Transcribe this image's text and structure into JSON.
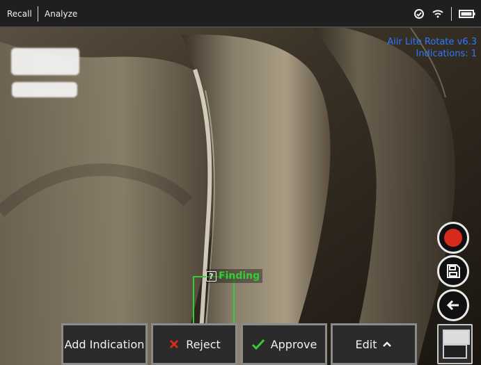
{
  "topbar": {
    "left_items": [
      "Recall",
      "Analyze"
    ],
    "status_icons": [
      "sync-check-icon",
      "wifi-icon",
      "battery-icon"
    ]
  },
  "overlay": {
    "software": "Aiir Lite Rotate v6.3",
    "indications": "Indications: 1"
  },
  "finding": {
    "label": "Finding"
  },
  "actions": {
    "add_indication": "Add Indication",
    "reject": "Reject",
    "approve": "Approve",
    "edit": "Edit"
  },
  "colors": {
    "overlay_text": "#2d78ff",
    "finding_green": "#35cc35",
    "record_red": "#d52a1c"
  }
}
